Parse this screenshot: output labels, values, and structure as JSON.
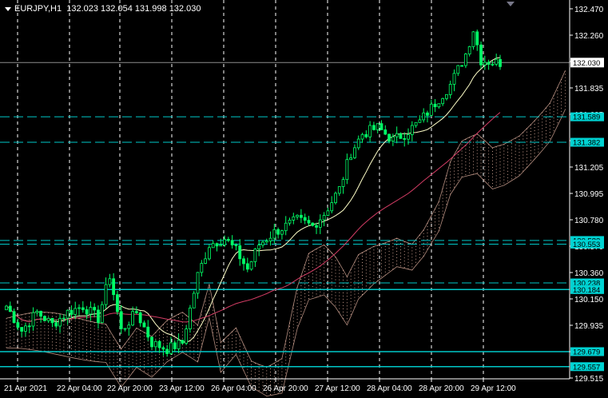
{
  "header": {
    "symbol": "EURJPY,H1",
    "ohlc": "132.023 132.054 131.998 132.030"
  },
  "chart_data": {
    "type": "candlestick",
    "title": "EURJPY,H1",
    "ylim": [
      129.515,
      132.47
    ],
    "y_ticks": [
      "132.470",
      "132.260",
      "132.050",
      "131.835",
      "131.625",
      "131.415",
      "131.205",
      "130.995",
      "130.780",
      "130.570",
      "130.360",
      "130.150",
      "129.935",
      "129.725",
      "129.515"
    ],
    "x_ticks": [
      "21 Apr 2021",
      "22 Apr 04:00",
      "22 Apr 20:00",
      "23 Apr 12:00",
      "26 Apr 04:00",
      "26 Apr 20:00",
      "27 Apr 12:00",
      "28 Apr 04:00",
      "28 Apr 20:00",
      "29 Apr 12:00"
    ],
    "current_price": "132.030",
    "horizontal_levels": [
      {
        "price": "131.589",
        "style": "dashed"
      },
      {
        "price": "131.382",
        "style": "dashed"
      },
      {
        "price": "130.583",
        "style": "dashed"
      },
      {
        "price": "130.553",
        "style": "dashed"
      },
      {
        "price": "130.238",
        "style": "dashed"
      },
      {
        "price": "130.184",
        "style": "solid"
      },
      {
        "price": "129.679",
        "style": "solid"
      },
      {
        "price": "129.557",
        "style": "solid"
      }
    ],
    "close_path": [
      [
        0,
        130.05
      ],
      [
        4,
        129.85
      ],
      [
        8,
        130.0
      ],
      [
        12,
        129.9
      ],
      [
        16,
        130.0
      ],
      [
        20,
        130.05
      ],
      [
        24,
        129.95
      ],
      [
        27,
        130.3
      ],
      [
        30,
        129.85
      ],
      [
        34,
        130.0
      ],
      [
        38,
        129.75
      ],
      [
        42,
        129.7
      ],
      [
        46,
        129.75
      ],
      [
        50,
        130.3
      ],
      [
        53,
        130.55
      ],
      [
        57,
        130.6
      ],
      [
        60,
        130.5
      ],
      [
        63,
        130.35
      ],
      [
        66,
        130.55
      ],
      [
        70,
        130.65
      ],
      [
        73,
        130.7
      ],
      [
        76,
        130.75
      ],
      [
        80,
        130.7
      ],
      [
        83,
        130.8
      ],
      [
        87,
        131.0
      ],
      [
        90,
        131.3
      ],
      [
        93,
        131.45
      ],
      [
        97,
        131.5
      ],
      [
        101,
        131.4
      ],
      [
        104,
        131.45
      ],
      [
        108,
        131.55
      ],
      [
        112,
        131.7
      ],
      [
        116,
        131.85
      ],
      [
        120,
        132.1
      ],
      [
        122,
        132.3
      ],
      [
        124,
        132.05
      ],
      [
        128,
        132.03
      ]
    ],
    "colors": {
      "bull": "#00ff66",
      "level_line": "#00c8c8",
      "label_bg": "#00d2d2",
      "ma_fast": "#ffffc8",
      "ma_slow": "#d23c64",
      "cloud_dots": "#ffc8b4",
      "grid": "#ffffff",
      "current_line": "#8c8c8c"
    }
  }
}
